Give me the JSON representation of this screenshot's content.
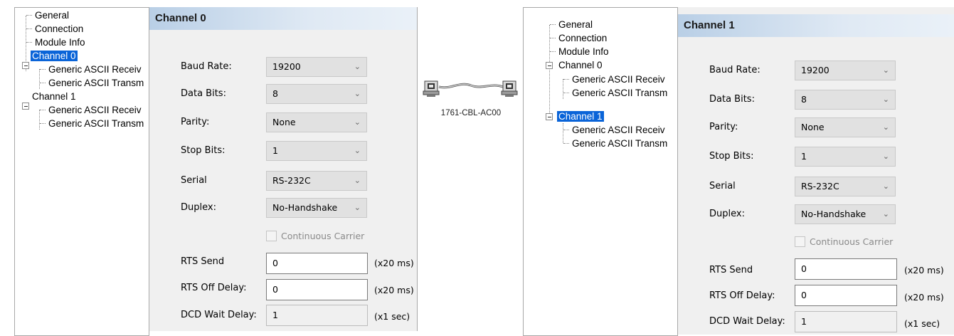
{
  "tree_items": {
    "general": "General",
    "connection": "Connection",
    "module_info": "Module Info",
    "channel0": "Channel 0",
    "channel0_rx": "Generic ASCII Receiv",
    "channel0_tx": "Generic ASCII Transm",
    "channel1": "Channel 1",
    "channel1_rx": "Generic ASCII Receiv",
    "channel1_tx": "Generic ASCII Transm"
  },
  "left": {
    "selected_node": "Channel 0",
    "header": "Channel 0",
    "baud_rate": "19200",
    "data_bits": "8",
    "parity": "None",
    "stop_bits": "1",
    "serial": "RS-232C",
    "duplex": "No-Handshake",
    "rts_send": "0",
    "rts_off_delay": "0",
    "dcd_wait_delay": "1"
  },
  "right": {
    "selected_node": "Channel 1",
    "header": "Channel 1",
    "baud_rate": "19200",
    "data_bits": "8",
    "parity": "None",
    "stop_bits": "1",
    "serial": "RS-232C",
    "duplex": "No-Handshake",
    "rts_send": "0",
    "rts_off_delay": "0",
    "dcd_wait_delay": "1"
  },
  "labels": {
    "baud_rate": "Baud Rate:",
    "data_bits": "Data Bits:",
    "parity": "Parity:",
    "stop_bits": "Stop Bits:",
    "serial": "Serial",
    "duplex": "Duplex:",
    "continuous_carrier": "Continuous Carrier",
    "rts_send": "RTS Send",
    "rts_off_delay": "RTS Off Delay:",
    "dcd_wait_delay": "DCD Wait Delay:"
  },
  "units": {
    "x20ms": "(x20 ms)",
    "x1sec": "(x1 sec)"
  },
  "cable": {
    "label": "1761-CBL-AC00"
  },
  "icons": {
    "dropdown": "chevron-down-icon",
    "tree_toggle": "minus-box-icon",
    "cable": "serial-cable-icon"
  },
  "colors": {
    "selection": "#0a64d8",
    "header_gradient_start": "#b9cfe6",
    "form_background": "#f0f0f0"
  }
}
